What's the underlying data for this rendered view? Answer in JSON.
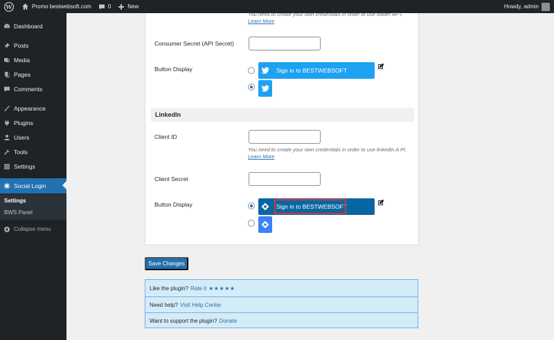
{
  "adminbar": {
    "site_name": "Promo bestwebsoft.com",
    "comments_count": "0",
    "new_label": "New",
    "howdy": "Howdy, admin"
  },
  "sidebar": {
    "items": [
      {
        "label": "Dashboard",
        "icon": "dashboard-icon"
      },
      {
        "label": "Posts",
        "icon": "pin-icon"
      },
      {
        "label": "Media",
        "icon": "media-icon"
      },
      {
        "label": "Pages",
        "icon": "pages-icon"
      },
      {
        "label": "Comments",
        "icon": "comments-icon"
      },
      {
        "label": "Appearance",
        "icon": "brush-icon"
      },
      {
        "label": "Plugins",
        "icon": "plugin-icon"
      },
      {
        "label": "Users",
        "icon": "users-icon"
      },
      {
        "label": "Tools",
        "icon": "wrench-icon"
      },
      {
        "label": "Settings",
        "icon": "settings-icon"
      },
      {
        "label": "Social Login",
        "icon": "social-login-icon"
      }
    ],
    "submenu": [
      "Settings",
      "BWS Panel"
    ],
    "collapse_label": "Collapse menu"
  },
  "twitter": {
    "desc_text": "You need to create your own credentials in order to use twitter AP I.",
    "learn_more": "Learn More",
    "secret_label": "Consumer Secret (API Secret)",
    "secret_value": "",
    "button_display_label": "Button Display",
    "button_text": "Sign in to BESTWEBSOFT"
  },
  "linkedin": {
    "section_title": "LinkedIn",
    "client_id_label": "Client ID",
    "client_id_value": "",
    "desc_text": "You need to create your own credentials in order to use linkedin A PI.",
    "learn_more": "Learn More",
    "client_secret_label": "Client Secret",
    "client_secret_value": "",
    "button_display_label": "Button Display",
    "button_text": "Sign in to BESTWEBSOFT"
  },
  "save_label": "Save Changes",
  "support": {
    "rate_text": "Like the plugin?",
    "rate_link": "Rate it",
    "stars": "★★★★★",
    "help_text": "Need help?",
    "help_link": "Visit Help Center",
    "donate_text": "Want to support the plugin?",
    "donate_link": "Donate"
  },
  "colors": {
    "accent": "#2271b1",
    "twitter": "#1da1f2",
    "linkedin": "#0a66a2",
    "admin_bg": "#1d2327"
  }
}
